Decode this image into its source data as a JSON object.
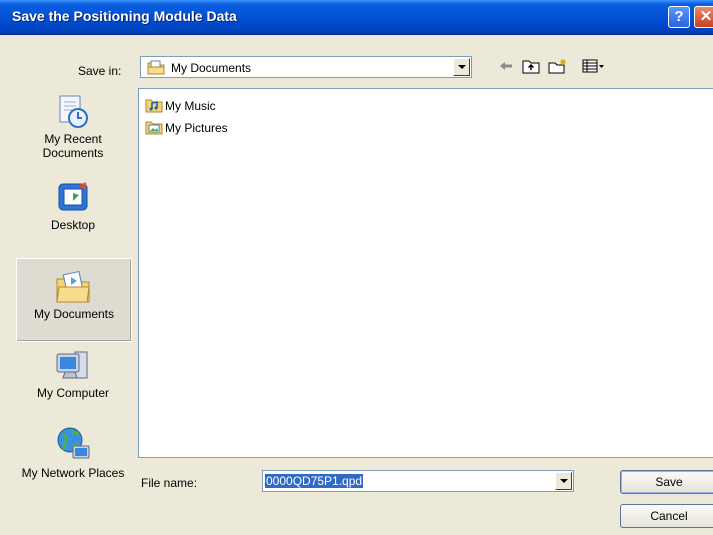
{
  "window": {
    "title": "Save the Positioning Module Data",
    "help_glyph": "?",
    "close_glyph": "✕"
  },
  "save_in": {
    "label": "Save in:",
    "value": "My Documents"
  },
  "toolbar": {
    "icons": [
      "back-arrow-icon",
      "up-folder-icon",
      "new-folder-icon",
      "view-menu-icon"
    ]
  },
  "places": [
    {
      "label": "My Recent Documents",
      "icon": "recent-documents-icon"
    },
    {
      "label": "Desktop",
      "icon": "desktop-icon"
    },
    {
      "label": "My Documents",
      "icon": "my-documents-icon",
      "selected": true
    },
    {
      "label": "My Computer",
      "icon": "my-computer-icon"
    },
    {
      "label": "My Network Places",
      "icon": "network-places-icon"
    }
  ],
  "files": [
    {
      "name": "My Music"
    },
    {
      "name": "My Pictures"
    }
  ],
  "file_name": {
    "label": "File name:",
    "value": "0000QD75P1.qpd"
  },
  "buttons": {
    "save": "Save",
    "cancel": "Cancel"
  },
  "colors": {
    "titlebar": "#0454d6",
    "dialog_bg": "#ece9d8",
    "selection": "#316ac5"
  }
}
